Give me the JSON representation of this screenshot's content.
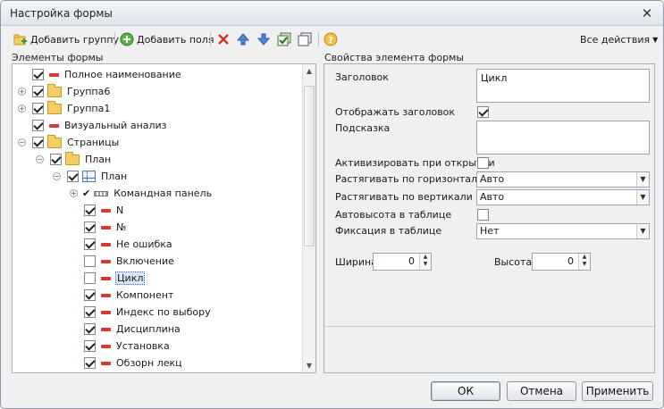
{
  "window": {
    "title": "Настройка формы"
  },
  "toolbar": {
    "add_group": "Добавить группу",
    "add_fields": "Добавить поля",
    "all_actions": "Все действия"
  },
  "left_panel": {
    "title": "Элементы формы"
  },
  "right_panel": {
    "title": "Свойства элемента формы"
  },
  "tree": {
    "items": [
      {
        "label": "Полное наименование",
        "checked": true,
        "icon": "field-dash-icon"
      },
      {
        "label": "Группа6",
        "checked": true,
        "icon": "folder-icon",
        "expander": "plus"
      },
      {
        "label": "Группа1",
        "checked": true,
        "icon": "folder-icon",
        "expander": "plus"
      },
      {
        "label": "Визуальный анализ",
        "checked": true,
        "icon": "field-dash-icon"
      },
      {
        "label": "Страницы",
        "checked": true,
        "icon": "folder-icon",
        "expander": "minus"
      },
      {
        "label": "План",
        "checked": true,
        "icon": "folder-icon",
        "expander": "minus"
      },
      {
        "label": "План",
        "checked": true,
        "icon": "table-icon",
        "expander": "minus"
      },
      {
        "label": "Командная панель",
        "checked": true,
        "icon": "command-panel-icon",
        "expander": "plus"
      },
      {
        "label": "N",
        "checked": true,
        "icon": "field-dash-icon"
      },
      {
        "label": "№",
        "checked": true,
        "icon": "field-dash-icon"
      },
      {
        "label": "Не ошибка",
        "checked": true,
        "icon": "field-dash-icon"
      },
      {
        "label": "Включение",
        "checked": false,
        "icon": "field-dash-icon"
      },
      {
        "label": "Цикл",
        "checked": false,
        "icon": "field-dash-icon",
        "selected": true
      },
      {
        "label": "Компонент",
        "checked": true,
        "icon": "field-dash-icon"
      },
      {
        "label": "Индекс по выбору",
        "checked": true,
        "icon": "field-dash-icon"
      },
      {
        "label": "Дисциплина",
        "checked": true,
        "icon": "field-dash-icon"
      },
      {
        "label": "Установка",
        "checked": true,
        "icon": "field-dash-icon"
      },
      {
        "label": "Обзорн лекц",
        "checked": true,
        "icon": "field-dash-icon"
      }
    ]
  },
  "props": {
    "header_label": "Заголовок",
    "header_value": "Цикл",
    "show_header_label": "Отображать заголовок",
    "show_header_checked": true,
    "hint_label": "Подсказка",
    "hint_value": "",
    "activate_label": "Активизировать при открытии",
    "activate_checked": false,
    "stretch_h_label": "Растягивать по горизонтали",
    "stretch_h_value": "Авто",
    "stretch_v_label": "Растягивать по вертикали",
    "stretch_v_value": "Авто",
    "autoheight_label": "Автовысота в таблице",
    "autoheight_checked": false,
    "fix_label": "Фиксация в таблице",
    "fix_value": "Нет",
    "width_label": "Ширина",
    "width_value": "0",
    "height_label": "Высота",
    "height_value": "0"
  },
  "footer": {
    "ok": "ОК",
    "cancel": "Отмена",
    "apply": "Применить"
  }
}
